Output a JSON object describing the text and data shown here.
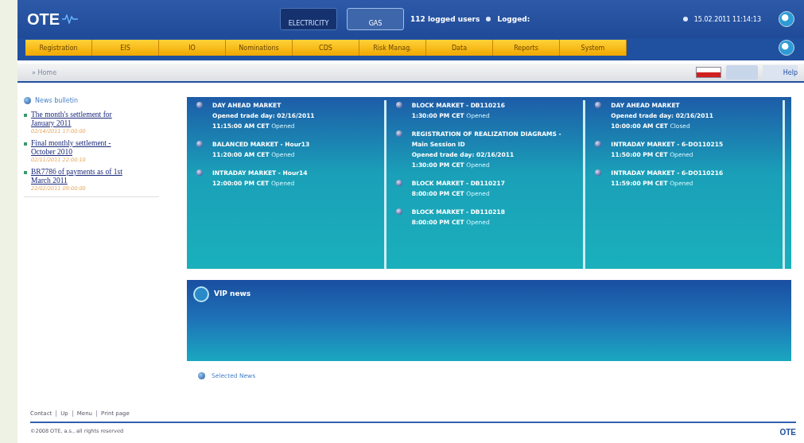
{
  "header": {
    "logo": "OTE",
    "tabs": [
      {
        "label": "ELECTRICITY",
        "selected": false
      },
      {
        "label": "GAS",
        "selected": true
      }
    ],
    "users": "112 logged users",
    "logged": "Logged:",
    "datetime": "15.02.2011 11:14:13"
  },
  "nav": [
    "Registration",
    "EIS",
    "IO",
    "Nominations",
    "CDS",
    "Risk Manag.",
    "Data",
    "Reports",
    "System"
  ],
  "breadcrumb": "» Home",
  "help": "Help",
  "bulletin": {
    "title": "News bulletin",
    "items": [
      {
        "title": "The month's settlement for January 2011",
        "date": "02/14/2011 17:00:00"
      },
      {
        "title": "Final monthly settlement - October 2010",
        "date": "02/11/2011 22:00:10"
      },
      {
        "title": "BR7786 of payments as of 1st March 2011",
        "date": "22/02/2011 09:00:00"
      }
    ]
  },
  "markets": [
    [
      {
        "title": "DAY AHEAD MARKET",
        "line": "Opened trade day: 02/16/2011",
        "time": "11:15:00 AM CET",
        "status": "Opened"
      },
      {
        "title": "BALANCED MARKET - Hour13",
        "time": "11:20:00 AM CET",
        "status": "Opened"
      },
      {
        "title": "INTRADAY MARKET - Hour14",
        "time": "12:00:00 PM CET",
        "status": "Opened"
      }
    ],
    [
      {
        "title": "BLOCK MARKET - DB110216",
        "time": "1:30:00 PM CET",
        "status": "Opened"
      },
      {
        "title": "REGISTRATION OF REALIZATION DIAGRAMS - Main Session ID",
        "line": "Opened trade day: 02/16/2011",
        "time": "1:30:00 PM CET",
        "status": "Opened"
      },
      {
        "title": "BLOCK MARKET - DB110217",
        "time": "8:00:00 PM CET",
        "status": "Opened"
      },
      {
        "title": "BLOCK MARKET - DB110218",
        "time": "8:00:00 PM CET",
        "status": "Opened"
      }
    ],
    [
      {
        "title": "DAY AHEAD MARKET",
        "line": "Opened trade day: 02/16/2011",
        "time": "10:00:00 AM CET",
        "status": "Closed"
      },
      {
        "title": "INTRADAY MARKET - 6-DO110215",
        "time": "11:50:00 PM CET",
        "status": "Opened"
      },
      {
        "title": "INTRADAY MARKET - 6-DO110216",
        "time": "11:59:00 PM CET",
        "status": "Opened"
      }
    ]
  ],
  "vip": "VIP news",
  "selected_news": "Selected News",
  "footer": {
    "links": [
      "Contact",
      "Up",
      "Menu",
      "Print page"
    ],
    "copyright": "©2008 OTE, a.s., all rights reserved",
    "logo": "OTE"
  }
}
